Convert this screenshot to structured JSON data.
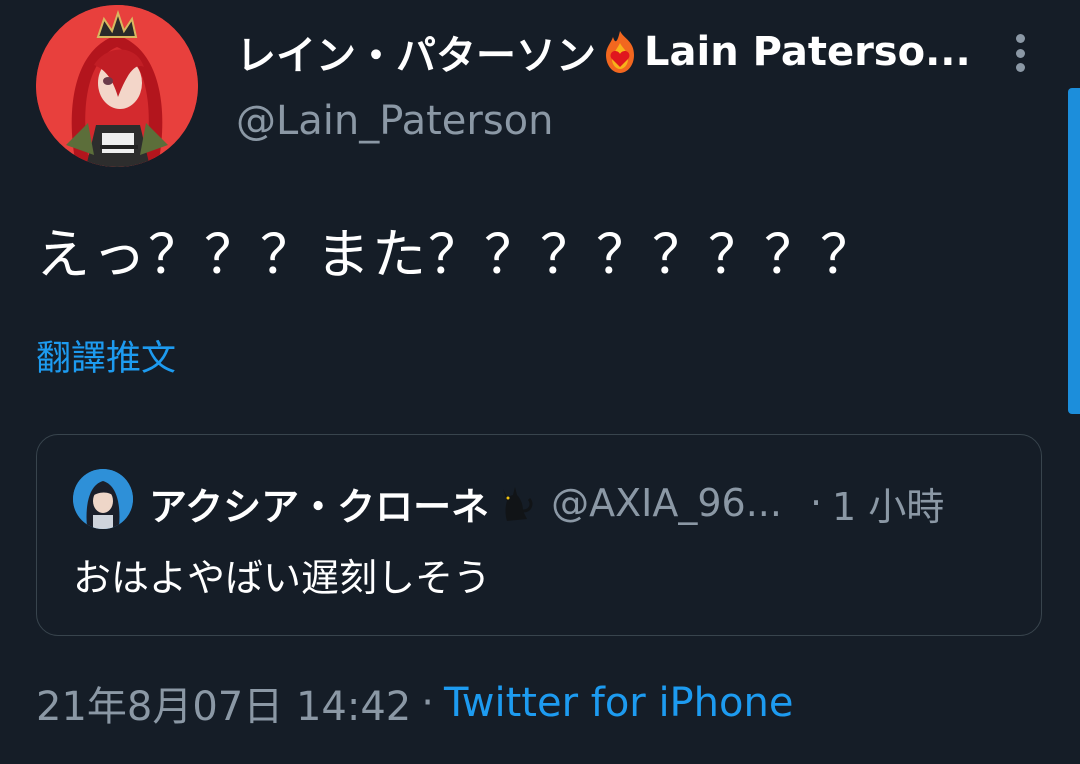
{
  "author": {
    "display_name_part1": "レイン・パターソン",
    "display_name_part2": "Lain Paterso...",
    "handle": "@Lain_Paterson",
    "avatar": "red-haired-character-avatar",
    "name_emoji": "fire-heart-emoji"
  },
  "more_icon": "vertical-dots-icon",
  "tweet": {
    "text": "えっ？？？また？？？？？？？？",
    "translate_label": "翻譯推文"
  },
  "quoted": {
    "display_name": "アクシア・クローネ",
    "name_emoji": "black-cat-emoji",
    "handle": "@AXIA_96...",
    "separator": "·",
    "time": "1 小時",
    "text": "おはよやばい遅刻しそう",
    "avatar": "dark-haired-character-avatar"
  },
  "meta": {
    "date": "21年8月07日 14:42",
    "separator": "·",
    "source": "Twitter for iPhone"
  },
  "colors": {
    "background": "#151d27",
    "accent": "#1d9bf0",
    "secondary_text": "#8b98a5",
    "avatar_bg": "#e8403d"
  }
}
